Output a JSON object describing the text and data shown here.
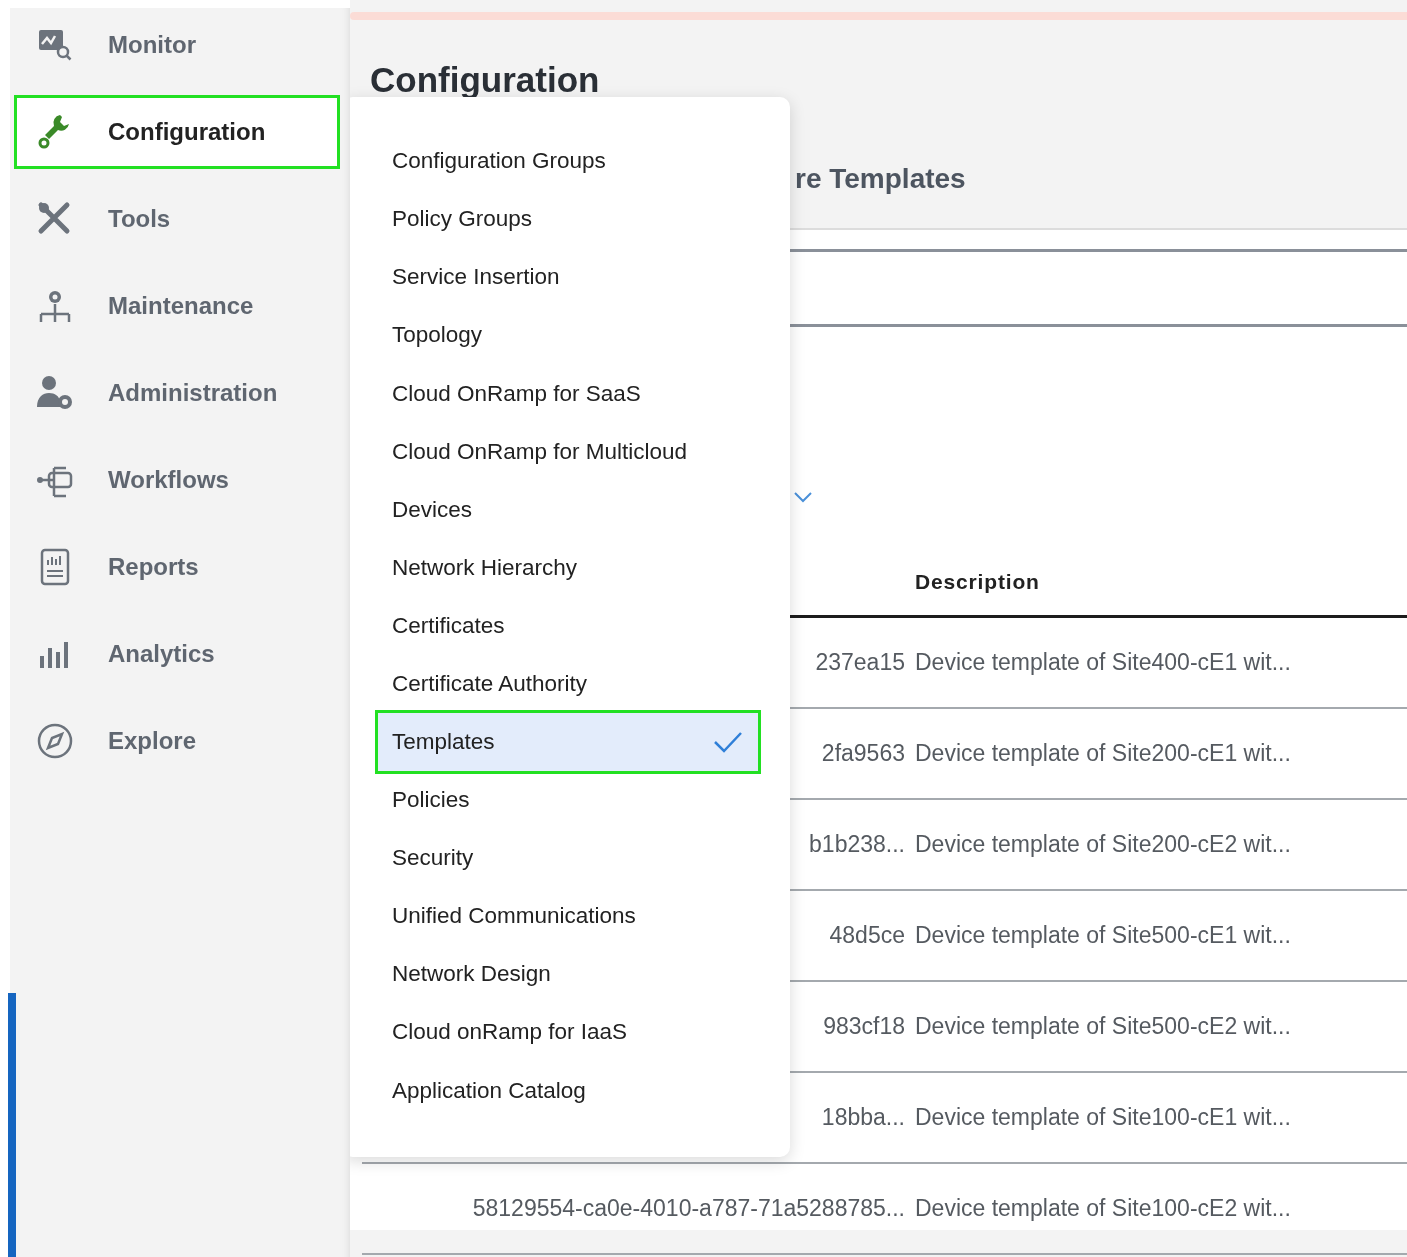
{
  "sidebar": {
    "items": [
      {
        "label": "Monitor",
        "selected": false
      },
      {
        "label": "Configuration",
        "selected": true
      },
      {
        "label": "Tools",
        "selected": false
      },
      {
        "label": "Maintenance",
        "selected": false
      },
      {
        "label": "Administration",
        "selected": false
      },
      {
        "label": "Workflows",
        "selected": false
      },
      {
        "label": "Reports",
        "selected": false
      },
      {
        "label": "Analytics",
        "selected": false
      },
      {
        "label": "Explore",
        "selected": false
      }
    ]
  },
  "page": {
    "title": "Configuration",
    "tab": "re Templates"
  },
  "menu": {
    "items": [
      {
        "label": "Configuration Groups",
        "selected": false
      },
      {
        "label": "Policy Groups",
        "selected": false
      },
      {
        "label": "Service Insertion",
        "selected": false
      },
      {
        "label": "Topology",
        "selected": false
      },
      {
        "label": "Cloud OnRamp for SaaS",
        "selected": false
      },
      {
        "label": "Cloud OnRamp for Multicloud",
        "selected": false
      },
      {
        "label": "Devices",
        "selected": false
      },
      {
        "label": "Network Hierarchy",
        "selected": false
      },
      {
        "label": "Certificates",
        "selected": false
      },
      {
        "label": "Certificate Authority",
        "selected": false
      },
      {
        "label": "Templates",
        "selected": true
      },
      {
        "label": "Policies",
        "selected": false
      },
      {
        "label": "Security",
        "selected": false
      },
      {
        "label": "Unified Communications",
        "selected": false
      },
      {
        "label": "Network Design",
        "selected": false
      },
      {
        "label": "Cloud onRamp for IaaS",
        "selected": false
      },
      {
        "label": "Application Catalog",
        "selected": false
      }
    ]
  },
  "table": {
    "columns": [
      "Description"
    ],
    "rows": [
      {
        "column_1": "237ea15",
        "description": "Device template of Site400-cE1 wit..."
      },
      {
        "column_1": "2fa9563",
        "description": "Device template of Site200-cE1 wit..."
      },
      {
        "column_1": "b1b238...",
        "description": "Device template of Site200-cE2 wit..."
      },
      {
        "column_1": "48d5ce",
        "description": "Device template of Site500-cE1 wit..."
      },
      {
        "column_1": "983cf18",
        "description": "Device template of Site500-cE2 wit..."
      },
      {
        "column_1": "18bba...",
        "description": "Device template of Site100-cE1 wit..."
      },
      {
        "column_1": "58129554-ca0e-4010-a787-71a5288785...",
        "description": "Device template of Site100-cE2 wit..."
      }
    ]
  }
}
